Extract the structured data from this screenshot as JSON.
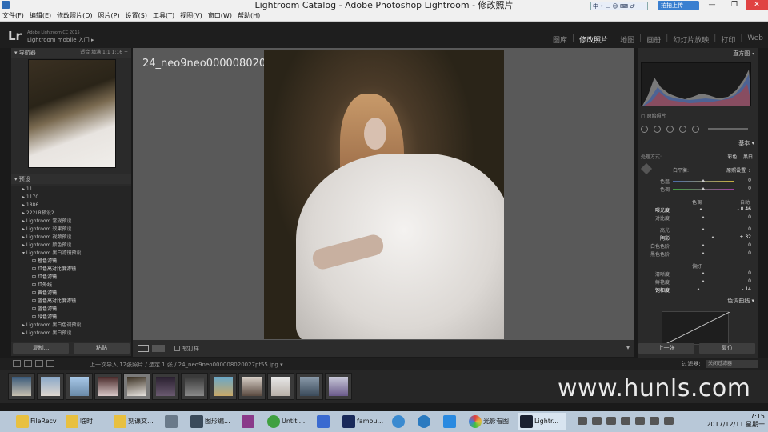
{
  "window": {
    "title": "Lightroom Catalog - Adobe Photoshop Lightroom - 修改照片",
    "min": "—",
    "max": "❐",
    "close": "✕"
  },
  "ime": "中 ◦ ▭ ☺ ⌨ ♂",
  "cloud_upload": "拍拍上传",
  "menu": [
    "文件(F)",
    "编辑(E)",
    "修改照片(D)",
    "照片(P)",
    "设置(S)",
    "工具(T)",
    "视图(V)",
    "窗口(W)",
    "帮助(H)"
  ],
  "identity": {
    "logo": "Lr",
    "line1": "Adobe Lightroom CC 2015",
    "line2": "Lightroom mobile 入门 ▸"
  },
  "modules": [
    "图库",
    "修改照片",
    "地图",
    "画册",
    "幻灯片放映",
    "打印",
    "Web"
  ],
  "active_module": "修改照片",
  "navigator": {
    "title": "▾ 导航器",
    "zoom": "适合  填满  1:1  1:16 ÷"
  },
  "presets": {
    "title": "▾ 预设",
    "add": "+",
    "folders": [
      "11",
      "1170",
      "1886",
      "222LR预设2",
      "Lightroom 常规预设",
      "Lightroom 效果预设",
      "Lightroom 视频预设",
      "Lightroom 颜色预设",
      "Lightroom 黑白滤镜预设"
    ],
    "children": [
      "橙色滤镜",
      "红色高对比度滤镜",
      "红色滤镜",
      "红外线",
      "黄色滤镜",
      "蓝色高对比度滤镜",
      "蓝色滤镜",
      "绿色滤镜"
    ],
    "after": [
      "Lightroom 黑白色调预设",
      "Lightroom 黑白预设"
    ]
  },
  "left_buttons": {
    "copy": "复制...",
    "paste": "粘贴"
  },
  "image": {
    "filename": "24_neo9neo000008020027pf55.jpg"
  },
  "toolbar": {
    "softproof": "软打样"
  },
  "histogram": {
    "title": "直方图 ◂",
    "original": "▢ 原始照片"
  },
  "basic": {
    "title": "基本 ▾",
    "treatment_label": "处理方式:",
    "treatment_color": "彩色",
    "treatment_bw": "黑白",
    "wb_label": "白平衡:",
    "wb_value": "原照设置 ÷",
    "temp": {
      "label": "色温",
      "value": "0"
    },
    "tint": {
      "label": "色调",
      "value": "0"
    },
    "tone_label": "色调",
    "auto": "自动",
    "exposure": {
      "label": "曝光度",
      "value": "- 0.46"
    },
    "contrast": {
      "label": "对比度",
      "value": "0"
    },
    "highlights": {
      "label": "高光",
      "value": "0"
    },
    "shadows": {
      "label": "阴影",
      "value": "+ 32"
    },
    "whites": {
      "label": "白色色阶",
      "value": "0"
    },
    "blacks": {
      "label": "黑色色阶",
      "value": "0"
    },
    "presence_label": "偏好",
    "clarity": {
      "label": "清晰度",
      "value": "0"
    },
    "vibrance": {
      "label": "鲜艳度",
      "value": "0"
    },
    "saturation": {
      "label": "饱和度",
      "value": "- 14"
    }
  },
  "tone_curve": {
    "title": "色调曲线 ▾"
  },
  "right_buttons": {
    "previous": "上一张",
    "reset": "复位"
  },
  "filter_bar": {
    "text": "上一次导入   12张照片 / 选定 1 张 / 24_neo9neo000008020027pf55.jpg ▾",
    "filter_label": "过滤器:",
    "filter_value": "关闭过滤器"
  },
  "watermark": "www.hunls.com",
  "taskbar": {
    "items": [
      "FileRecv",
      "临时",
      "刻课文...",
      "",
      "图形编...",
      "",
      "Untitl...",
      "",
      "famou...",
      "",
      "",
      "",
      "光影看图",
      "Lightr..."
    ],
    "time": "7:15",
    "date": "2017/12/11 星期一"
  }
}
